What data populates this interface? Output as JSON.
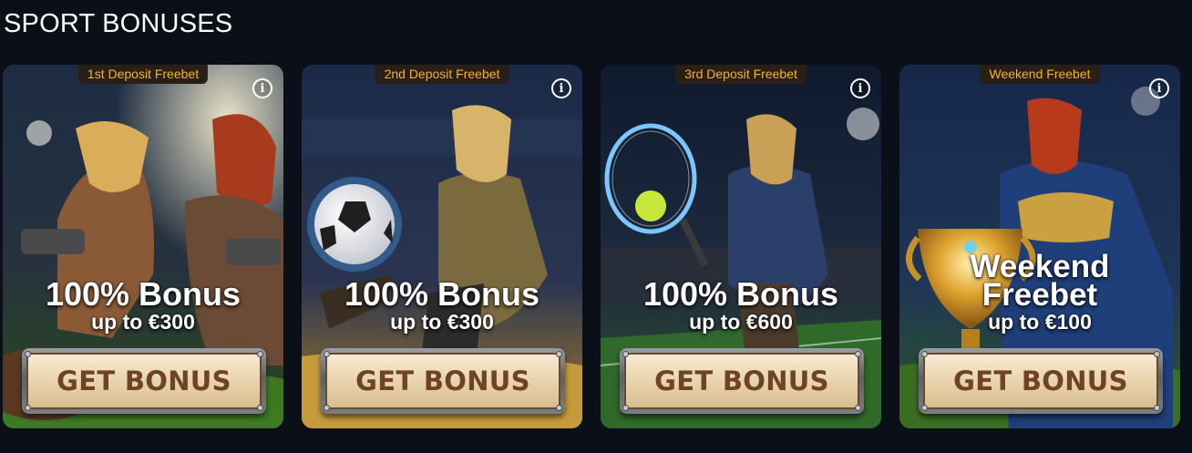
{
  "section": {
    "title": "SPORT BONUSES"
  },
  "cards": [
    {
      "tag": "1st Deposit Freebet",
      "headline": "100% Bonus",
      "subline": "up to €300",
      "button": "GET BONUS",
      "info_icon": "i"
    },
    {
      "tag": "2nd Deposit Freebet",
      "headline": "100% Bonus",
      "subline": "up to €300",
      "button": "GET BONUS",
      "info_icon": "i"
    },
    {
      "tag": "3rd Deposit Freebet",
      "headline": "100% Bonus",
      "subline": "up to €600",
      "button": "GET BONUS",
      "info_icon": "i"
    },
    {
      "tag": "Weekend Freebet",
      "headline_line1": "Weekend",
      "headline_line2": "Freebet",
      "subline": "up to €100",
      "button": "GET BONUS",
      "info_icon": "i"
    }
  ],
  "colors": {
    "background": "#0b0f17",
    "tag_text": "#f2b233",
    "button_text": "#6e4524"
  }
}
